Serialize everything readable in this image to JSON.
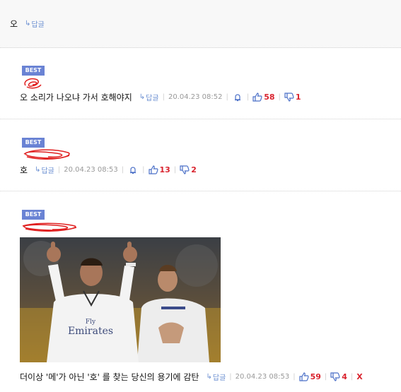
{
  "comments": [
    {
      "text": "오",
      "reply": "답글"
    },
    {
      "badge": "BEST",
      "text": "오 소리가 나오냐 가서 호해야지",
      "reply": "답글",
      "date": "20.04.23 08:52",
      "up": "58",
      "down": "1"
    },
    {
      "badge": "BEST",
      "text": "호",
      "reply": "답글",
      "date": "20.04.23 08:53",
      "up": "13",
      "down": "2"
    },
    {
      "badge": "BEST",
      "text": "더이상 '메'가 아닌 '호' 를 찾는 당신의 용기에 감탄",
      "reply": "답글",
      "date": "20.04.23 08:53",
      "up": "59",
      "down": "4",
      "delete": "X"
    }
  ],
  "colors": {
    "accent": "#6a83d4",
    "count": "#d9232e",
    "reply": "#6b8fd1"
  },
  "icons": [
    "reply-arrow-icon",
    "bell-icon",
    "thumbs-up-icon",
    "thumbs-down-icon"
  ]
}
